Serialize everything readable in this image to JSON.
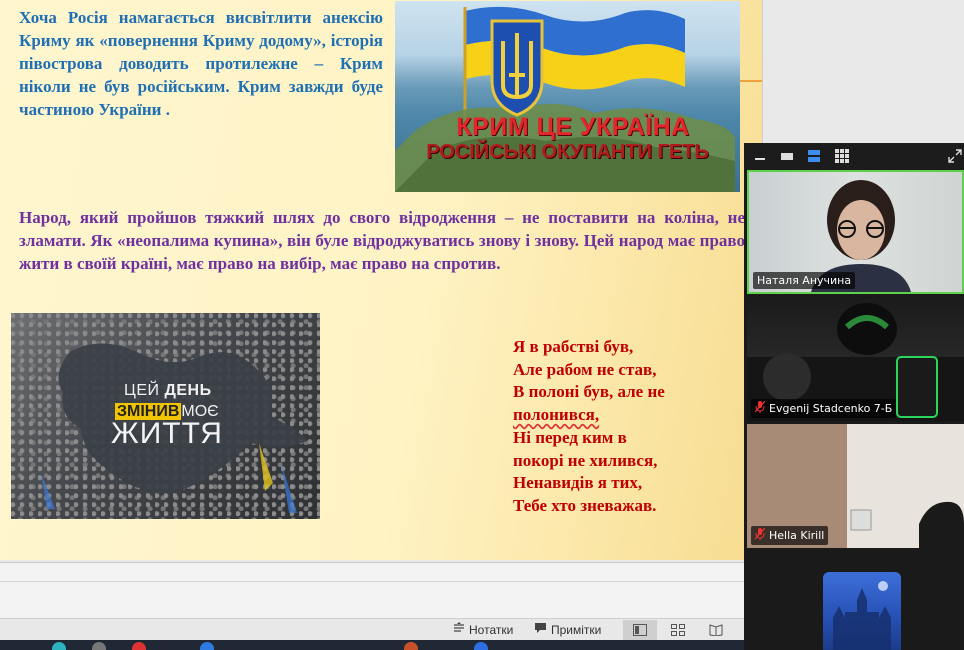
{
  "slide": {
    "paragraph1": "Хоча Росія намагається висвітлити анексію Криму як «повернення Криму додому», історія півострова доводить протилежне – Крим ніколи не був російським. Крим завжди буде частиною України .",
    "paragraph2": "Народ, який пройшов тяжкий шлях до свого відродження – не поставити на коліна, не зламати. Як «неопалима купина», він буле відроджуватись знову і знову. Цей народ має право жити в своїй країні, має право на вибір, має право на спротив.",
    "image1": {
      "line1": "КРИМ ЦЕ УКРАЇНА",
      "line2": "РОСІЙСЬКІ ОКУПАНТИ ГЕТЬ"
    },
    "image2": {
      "word1": "ЦЕЙ",
      "word2": "ДЕНЬ",
      "word3": "ЗМІНИВ",
      "word4": "МОЄ",
      "word5": "ЖИТТЯ"
    },
    "poem": [
      "Я в рабстві був,",
      "Але рабом не став,",
      "В полоні був, але не",
      "полонився,",
      "Ні перед ким в",
      "покорі не хилився,",
      "Ненавидів я тих,",
      "Тебе хто зневажав."
    ]
  },
  "statusbar": {
    "notes_label": "Нотатки",
    "comments_label": "Примітки"
  },
  "video_panel": {
    "participants": [
      {
        "name": "Наталя Анучина",
        "muted": false
      },
      {
        "name": "Evgenij Stadcenko 7-Б",
        "muted": true
      },
      {
        "name": "Hella Kirill",
        "muted": true
      }
    ],
    "colors": {
      "active_speaker_border": "#5ed04b",
      "muted_icon": "#e33333"
    }
  },
  "colors": {
    "paragraph1": "#1f6fb5",
    "paragraph2": "#7030a0",
    "poem": "#c00000"
  }
}
